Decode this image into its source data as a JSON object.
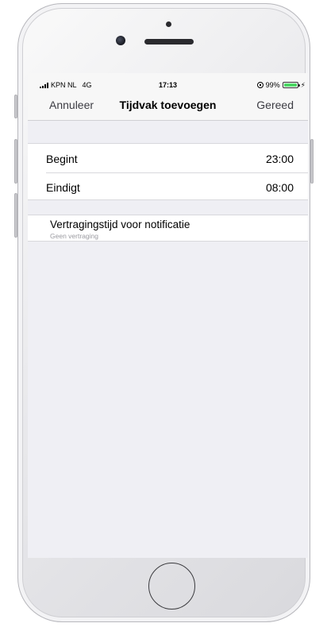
{
  "status_bar": {
    "carrier": "KPN NL",
    "network": "4G",
    "time": "17:13",
    "battery_percent": "99%",
    "battery_level": 0.99,
    "battery_color": "#4cd964"
  },
  "nav": {
    "cancel_label": "Annuleer",
    "title": "Tijdvak toevoegen",
    "done_label": "Gereed"
  },
  "time_rows": [
    {
      "label": "Begint",
      "value": "23:00"
    },
    {
      "label": "Eindigt",
      "value": "08:00"
    }
  ],
  "notification": {
    "title": "Vertragingstijd voor notificatie",
    "subtitle": "Geen vertraging"
  },
  "icons": {
    "charging": "⚡"
  }
}
